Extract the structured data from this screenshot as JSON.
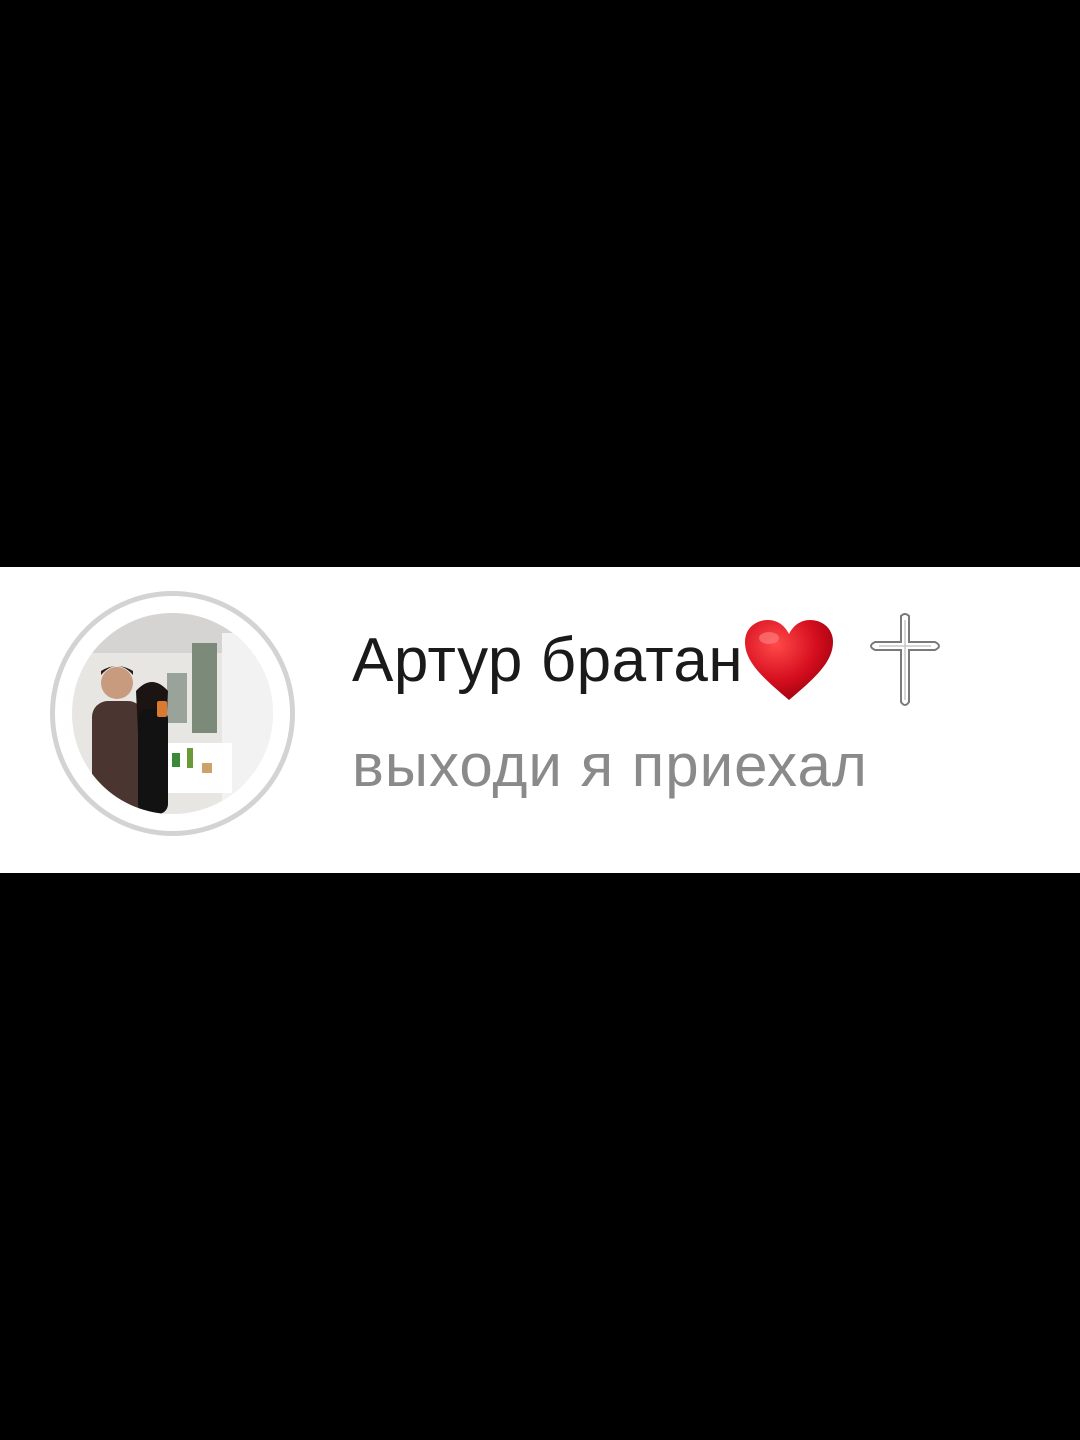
{
  "notification": {
    "contact_name": "Артур братан",
    "message": "выходи я приехал",
    "icons": {
      "avatar": "profile-photo",
      "heart": "red-heart-emoji",
      "cross": "latin-cross-symbol"
    },
    "colors": {
      "background": "#000000",
      "card": "#ffffff",
      "name": "#1a1a1a",
      "message": "#8a8a8a",
      "ring": "#d3d3d3",
      "heart": "#d0021b"
    }
  }
}
